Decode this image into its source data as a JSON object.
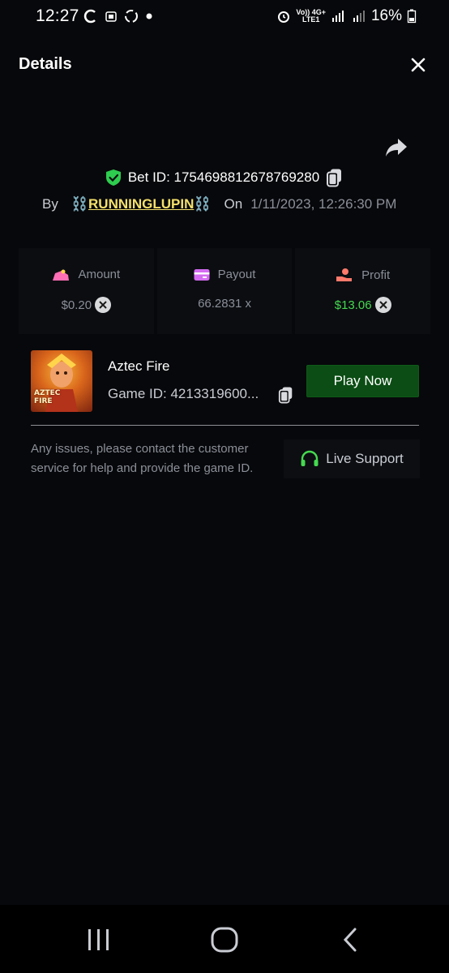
{
  "status_bar": {
    "time": "12:27",
    "battery": "16%",
    "network_top": "Vo)) 4G+",
    "network_bottom": "LTE1"
  },
  "header": {
    "title": "Details"
  },
  "bet": {
    "label": "Bet ID: 1754698812678769280",
    "by_label": "By",
    "chain_left": "⛓️",
    "username": "RUNNINGLUPIN",
    "chain_right": "⛓️",
    "on_label": "On",
    "date": "1/11/2023, 12:26:30 PM"
  },
  "stats": {
    "amount_label": "Amount",
    "amount_value": "$0.20",
    "payout_label": "Payout",
    "payout_value": "66.2831 x",
    "profit_label": "Profit",
    "profit_value": "$13.06"
  },
  "game": {
    "name": "Aztec Fire",
    "id_text": "Game ID: 4213319600...",
    "play_label": "Play Now"
  },
  "support": {
    "message": "Any issues, please contact the customer service for help and provide the game ID.",
    "button_label": "Live Support"
  },
  "colors": {
    "background": "#07080b",
    "accent_green": "#0b4d14",
    "profit_green": "#45d94f",
    "username_yellow": "#f5e06a"
  }
}
